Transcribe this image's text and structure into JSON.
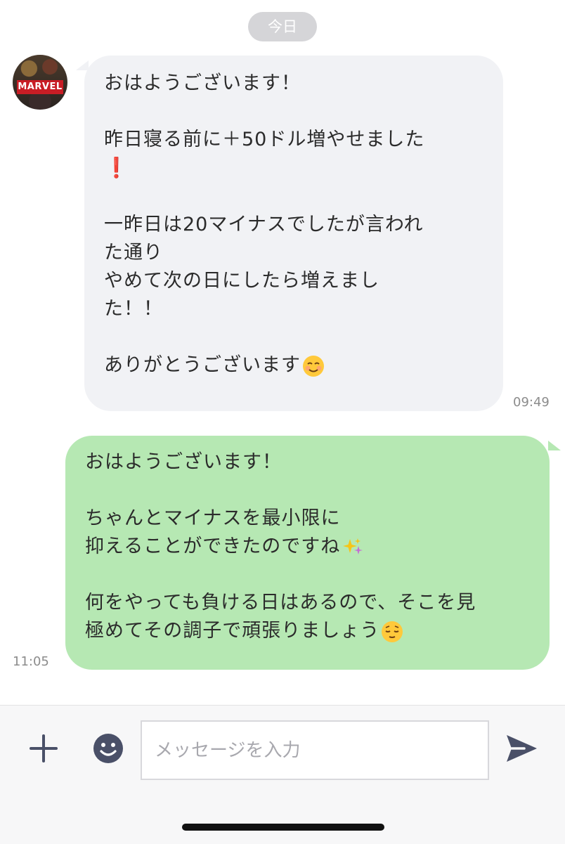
{
  "date_separator": "今日",
  "incoming": {
    "avatar_text": "MARVEL",
    "lines": {
      "l1": "おはようございます！",
      "l2": "昨日寝る前に＋50ドル増やせました",
      "l2_emoji": "❗",
      "l3": "一昨日は20マイナスでしたが言われ",
      "l4": "た通り",
      "l5": "やめて次の日にしたら増えまし",
      "l6": "た！！",
      "l7": "ありがとうございます",
      "l7_emoji": "smiling-face-icon"
    },
    "time": "09:49"
  },
  "outgoing": {
    "lines": {
      "l1": "おはようございます！",
      "l2": "ちゃんとマイナスを最小限に",
      "l3": "抑えることができたのですね",
      "l3_emoji": "sparkles-icon",
      "l4": "何をやっても負ける日はあるので、そこを見",
      "l5": "極めてその調子で頑張りましょう",
      "l5_emoji": "relieved-face-icon"
    },
    "time": "11:05"
  },
  "composer": {
    "placeholder": "メッセージを入力",
    "icons": [
      "plus-icon",
      "smile-icon",
      "send-icon"
    ]
  },
  "colors": {
    "incoming_bubble": "#f1f2f5",
    "outgoing_bubble": "#b6e8b3",
    "date_pill": "#d5d5d8",
    "icon": "#4a5068"
  }
}
